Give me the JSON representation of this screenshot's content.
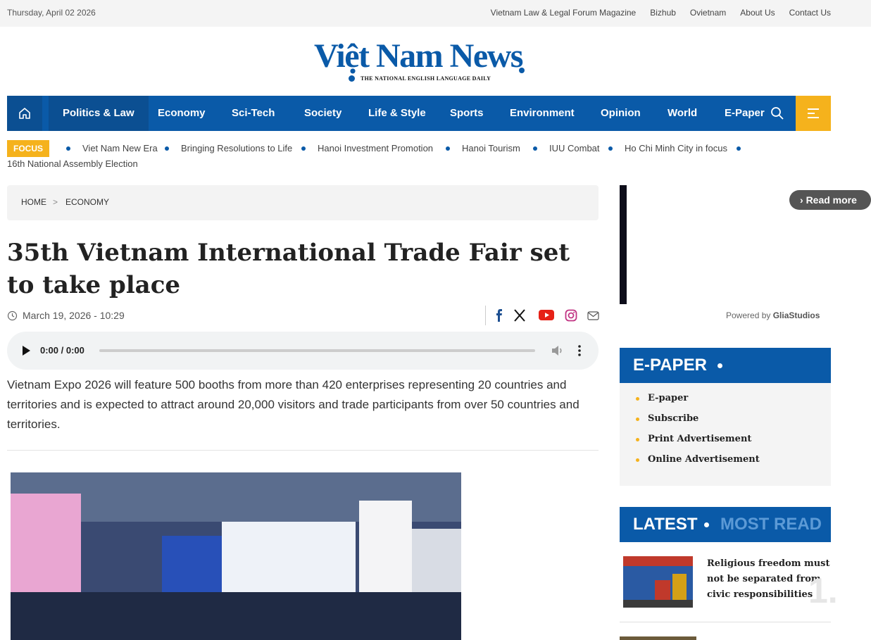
{
  "topbar": {
    "date": "Thursday, April 02 2026",
    "links": [
      "Vietnam Law & Legal Forum Magazine",
      "Bizhub",
      "Ovietnam",
      "About Us",
      "Contact Us"
    ]
  },
  "logo": {
    "name": "Việt Nam News",
    "tagline": "THE NATIONAL ENGLISH LANGUAGE DAILY"
  },
  "nav": {
    "items": [
      "Politics & Law",
      "Economy",
      "Sci-Tech",
      "Society",
      "Life & Style",
      "Sports",
      "Environment",
      "Opinion",
      "World",
      "E-Paper"
    ],
    "active": "Politics & Law"
  },
  "focus": {
    "label": "FOCUS",
    "items": [
      "Viet Nam New Era",
      "Bringing Resolutions to Life",
      "Hanoi Investment Promotion",
      "Hanoi Tourism",
      "IUU Combat",
      "Ho Chi Minh City in focus",
      "16th National Assembly Election"
    ]
  },
  "breadcrumb": {
    "home": "HOME",
    "sep": ">",
    "section": "ECONOMY"
  },
  "article": {
    "title": "35th Vietnam International Trade Fair set to take place",
    "date": "March 19, 2026 - 10:29",
    "audio_time": "0:00 / 0:00",
    "summary": "Vietnam Expo 2026 will feature 500 booths from more than 420 enterprises representing 20 countries and territories and is expected to attract around 20,000 visitors and trade participants from over 50 countries and territories."
  },
  "ad": {
    "read_more": "Read more",
    "powered_prefix": "Powered by ",
    "powered_brand": "GliaStudios"
  },
  "epaper": {
    "title": "E-PAPER",
    "links": [
      "E-paper",
      "Subscribe",
      "Print Advertisement",
      "Online Advertisement"
    ]
  },
  "latest": {
    "tab_latest": "LATEST",
    "tab_most_read": "MOST READ",
    "items": [
      {
        "title": "Religious freedom must not be separated from civic responsibilities",
        "rank": "1."
      }
    ]
  },
  "colors": {
    "brand_blue": "#0a5aa8",
    "accent_yellow": "#f5b21c"
  }
}
